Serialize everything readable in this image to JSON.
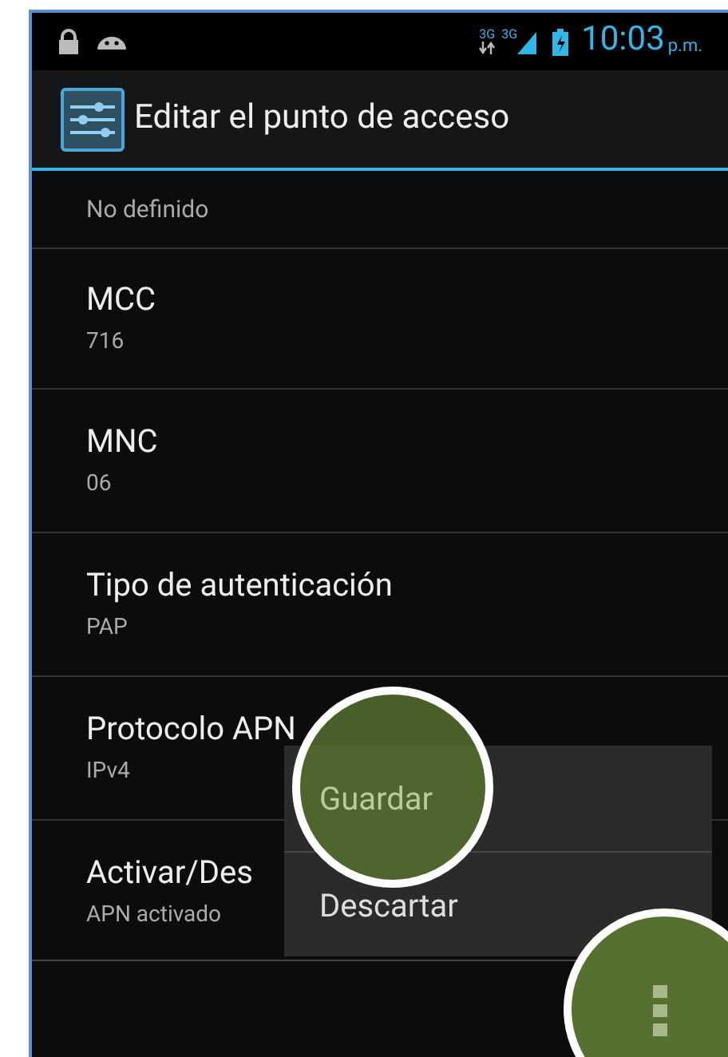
{
  "status_bar": {
    "network_1": "3G",
    "network_2": "3G",
    "time": "10:03",
    "time_suffix": "p.m."
  },
  "action_bar": {
    "title": "Editar el punto de acceso"
  },
  "partial_row": {
    "value": "No definido"
  },
  "settings": [
    {
      "title": "MCC",
      "value": "716"
    },
    {
      "title": "MNC",
      "value": "06"
    },
    {
      "title": "Tipo de autenticación",
      "value": "PAP"
    },
    {
      "title": "Protocolo APN",
      "value": "IPv4"
    },
    {
      "title": "Activar/Des",
      "value": "APN activado"
    }
  ],
  "overflow_menu": {
    "items": [
      {
        "label": "Guardar",
        "highlighted": true
      },
      {
        "label": "Descartar",
        "highlighted": false
      }
    ]
  },
  "menu_button": {
    "highlighted": true
  }
}
